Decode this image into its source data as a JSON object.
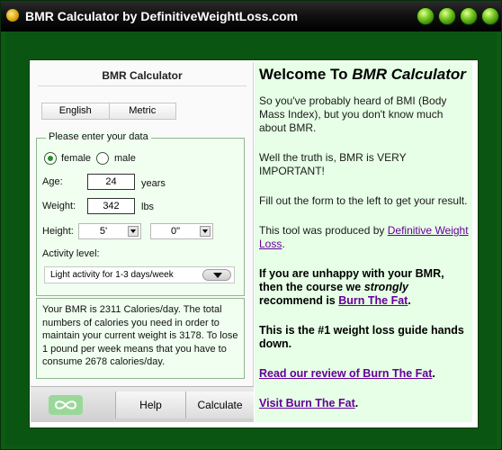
{
  "window": {
    "title": "BMR Calculator by DefinitiveWeightLoss.com"
  },
  "calculator": {
    "title": "BMR Calculator",
    "tabs": [
      "English",
      "Metric"
    ],
    "legend": "Please enter your data",
    "gender": {
      "female": "female",
      "male": "male",
      "selected": "female"
    },
    "age": {
      "label": "Age:",
      "value": "24",
      "unit": "years"
    },
    "weight": {
      "label": "Weight:",
      "value": "342",
      "unit": "lbs"
    },
    "height": {
      "label": "Height:",
      "feet": "5'",
      "inches": "0\""
    },
    "activity": {
      "label": "Activity level:",
      "selected": "Light activity for 1-3 days/week"
    },
    "result": "Your BMR is 2311 Calories/day. The total numbers of calories you need in order to maintain your  current weight is 3178. To lose 1 pound per week means that you have to consume 2678 calories/day.",
    "buttons": {
      "help": "Help",
      "calculate": "Calculate"
    }
  },
  "info": {
    "welcome_prefix": "Welcome To ",
    "welcome_em": "BMR Calculator",
    "p1": "So you've probably heard of BMI (Body Mass Index), but you don't know much about BMR.",
    "p2": "Well the truth is, BMR is VERY IMPORTANT!",
    "p3": "Fill out the form to the left to get your result.",
    "p4_prefix": "This tool was produced by ",
    "p4_link": "Definitive Weight Loss",
    "p4_suffix": ".",
    "p5_a": "If you are unhappy with your BMR, then the course we ",
    "p5_em": "strongly",
    "p5_b": " recommend is ",
    "p5_link": "Burn The Fat",
    "p5_suffix": ".",
    "p6": "This is the #1 weight loss guide hands down.",
    "p7_link": "Read our review of Burn The Fat",
    "p7_suffix": ".",
    "p8_link": "Visit Burn The Fat",
    "p8_suffix": "."
  },
  "colors": {
    "frame": "#0b5512",
    "info_bg": "#e6ffe6",
    "form_bg": "#f0fff0",
    "link": "#660099",
    "window_button": "#7fd02a"
  },
  "icons": [
    "app-icon",
    "minimize-icon",
    "maximize-icon",
    "restore-icon",
    "close-icon",
    "dropdown-arrow-icon",
    "logo-icon"
  ]
}
